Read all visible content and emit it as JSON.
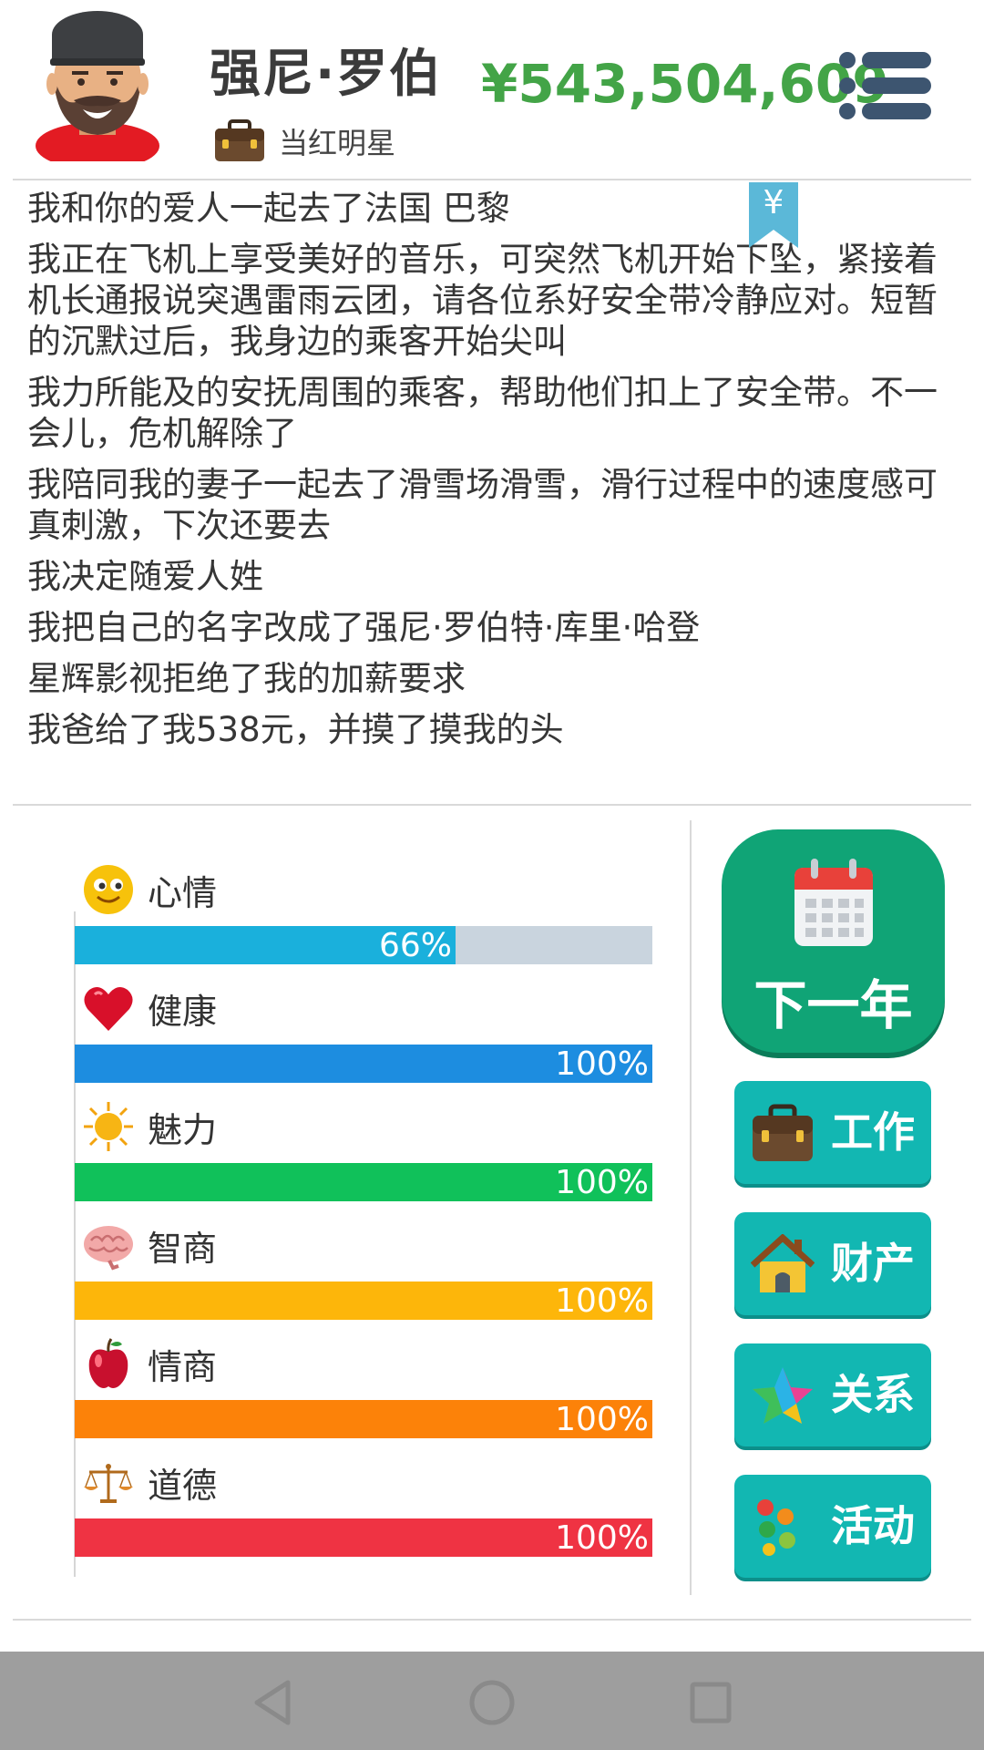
{
  "header": {
    "player_name": "强尼·罗伯",
    "job_title": "当红明星",
    "money": "¥543,504,609"
  },
  "log": {
    "bookmark_symbol": "¥",
    "entries": [
      "我和你的爱人一起去了法国 巴黎",
      "我正在飞机上享受美好的音乐，可突然飞机开始下坠，紧接着机长通报说突遇雷雨云团，请各位系好安全带冷静应对。短暂的沉默过后，我身边的乘客开始尖叫",
      "我力所能及的安抚周围的乘客，帮助他们扣上了安全带。不一会儿，危机解除了",
      "我陪同我的妻子一起去了滑雪场滑雪，滑行过程中的速度感可真刺激，下次还要去",
      "我决定随爱人姓",
      "我把自己的名字改成了强尼·罗伯特·库里·哈登",
      "星辉影视拒绝了我的加薪要求",
      "我爸给了我538元，并摸了摸我的头"
    ]
  },
  "stats": [
    {
      "label": "心情",
      "value": 66,
      "text": "66%",
      "color": "#1ab0dc",
      "track": "#c9d4de",
      "icon": "smiley-icon"
    },
    {
      "label": "健康",
      "value": 100,
      "text": "100%",
      "color": "#1d8de0",
      "track": "#c9d4de",
      "icon": "heart-icon"
    },
    {
      "label": "魅力",
      "value": 100,
      "text": "100%",
      "color": "#10c15a",
      "track": "#c9d4de",
      "icon": "sun-icon"
    },
    {
      "label": "智商",
      "value": 100,
      "text": "100%",
      "color": "#fdb60a",
      "track": "#c9d4de",
      "icon": "brain-icon"
    },
    {
      "label": "情商",
      "value": 100,
      "text": "100%",
      "color": "#fc8209",
      "track": "#c9d4de",
      "icon": "apple-icon"
    },
    {
      "label": "道德",
      "value": 100,
      "text": "100%",
      "color": "#ef3343",
      "track": "#c9d4de",
      "icon": "scale-icon"
    }
  ],
  "actions": {
    "next_year": "下一年",
    "work": "工作",
    "property": "财产",
    "relations": "关系",
    "activities": "活动"
  },
  "colors": {
    "money_green": "#43a447",
    "next_year_bg": "#10a476",
    "side_button_bg": "#12b7b2",
    "navbar_bg": "#9e9e9e"
  }
}
